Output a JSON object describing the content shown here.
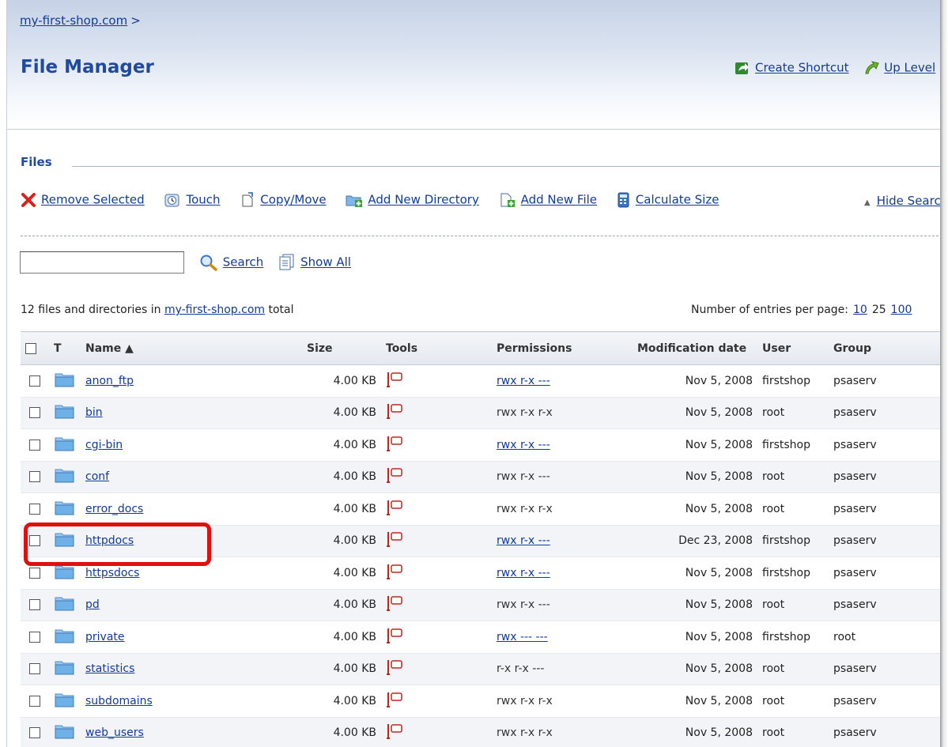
{
  "breadcrumb": {
    "link": "my-first-shop.com",
    "separator": ">"
  },
  "page_title": "File Manager",
  "header_actions": [
    {
      "label": "Create Shortcut",
      "icon": "create-shortcut-icon"
    },
    {
      "label": "Up Level",
      "icon": "up-level-icon"
    }
  ],
  "section_label": "Files",
  "toolbar": [
    {
      "label": "Remove Selected",
      "icon": "remove-icon"
    },
    {
      "label": "Touch",
      "icon": "touch-icon"
    },
    {
      "label": "Copy/Move",
      "icon": "copy-move-icon"
    },
    {
      "label": "Add New Directory",
      "icon": "add-directory-icon"
    },
    {
      "label": "Add New File",
      "icon": "add-file-icon"
    },
    {
      "label": "Calculate Size",
      "icon": "calculate-size-icon"
    }
  ],
  "hide_search": "Hide Search",
  "search": {
    "value": "",
    "button": "Search",
    "show_all": "Show All"
  },
  "summary": {
    "prefix": "12 files and directories in",
    "link": "my-first-shop.com",
    "suffix": "total"
  },
  "per_page": {
    "label": "Number of entries per page:",
    "options": [
      "10",
      "25",
      "100"
    ]
  },
  "columns": [
    "T",
    "Name ▲",
    "Size",
    "Tools",
    "Permissions",
    "Modification date",
    "User",
    "Group"
  ],
  "rows": [
    {
      "name": "anon_ftp",
      "size": "4.00 KB",
      "perm": "rwx r-x ---",
      "perm_link": true,
      "date": "Nov 5, 2008",
      "user": "firstshop",
      "group": "psaserv"
    },
    {
      "name": "bin",
      "size": "4.00 KB",
      "perm": "rwx r-x r-x",
      "perm_link": false,
      "date": "Nov 5, 2008",
      "user": "root",
      "group": "psaserv"
    },
    {
      "name": "cgi-bin",
      "size": "4.00 KB",
      "perm": "rwx r-x ---",
      "perm_link": true,
      "date": "Nov 5, 2008",
      "user": "firstshop",
      "group": "psaserv"
    },
    {
      "name": "conf",
      "size": "4.00 KB",
      "perm": "rwx r-x ---",
      "perm_link": false,
      "date": "Nov 5, 2008",
      "user": "root",
      "group": "psaserv"
    },
    {
      "name": "error_docs",
      "size": "4.00 KB",
      "perm": "rwx r-x r-x",
      "perm_link": false,
      "date": "Nov 5, 2008",
      "user": "root",
      "group": "psaserv"
    },
    {
      "name": "httpdocs",
      "size": "4.00 KB",
      "perm": "rwx r-x ---",
      "perm_link": true,
      "date": "Dec 23, 2008",
      "user": "firstshop",
      "group": "psaserv"
    },
    {
      "name": "httpsdocs",
      "size": "4.00 KB",
      "perm": "rwx r-x ---",
      "perm_link": true,
      "date": "Nov 5, 2008",
      "user": "firstshop",
      "group": "psaserv"
    },
    {
      "name": "pd",
      "size": "4.00 KB",
      "perm": "rwx r-x ---",
      "perm_link": false,
      "date": "Nov 5, 2008",
      "user": "root",
      "group": "psaserv"
    },
    {
      "name": "private",
      "size": "4.00 KB",
      "perm": "rwx --- ---",
      "perm_link": true,
      "date": "Nov 5, 2008",
      "user": "firstshop",
      "group": "root"
    },
    {
      "name": "statistics",
      "size": "4.00 KB",
      "perm": "r-x r-x ---",
      "perm_link": false,
      "date": "Nov 5, 2008",
      "user": "root",
      "group": "psaserv"
    },
    {
      "name": "subdomains",
      "size": "4.00 KB",
      "perm": "rwx r-x r-x",
      "perm_link": false,
      "date": "Nov 5, 2008",
      "user": "root",
      "group": "psaserv"
    },
    {
      "name": "web_users",
      "size": "4.00 KB",
      "perm": "rwx r-x r-x",
      "perm_link": false,
      "date": "Nov 5, 2008",
      "user": "root",
      "group": "psaserv"
    }
  ],
  "colors": {
    "link": "#123a9b",
    "title": "#1f4aa0",
    "highlight": "#e01010",
    "folder": "#5aa6df"
  }
}
